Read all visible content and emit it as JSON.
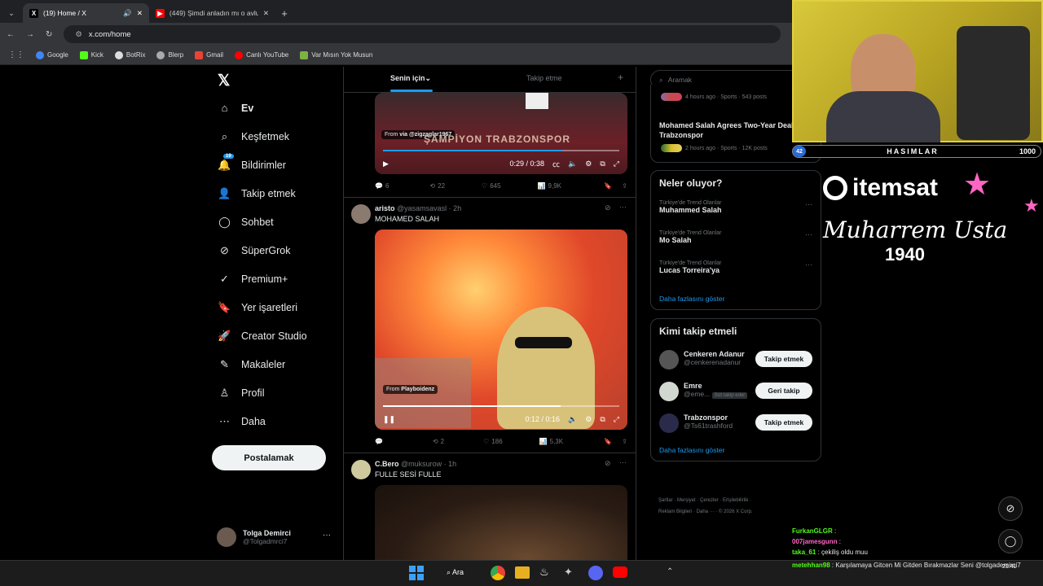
{
  "browser": {
    "tabs": [
      {
        "title": "(19) Home / X",
        "active": true
      },
      {
        "title": "(449) Şimdi anladın mı o avludaki",
        "active": false
      }
    ],
    "address": "x.com/home",
    "bookmarks": [
      "Google",
      "Kick",
      "BotRix",
      "Blerp",
      "Gmail",
      "Canlı YouTube",
      "Var Mısın Yok Musun"
    ]
  },
  "nav": {
    "items": [
      "Ev",
      "Keşfetmek",
      "Bildirimler",
      "Takip etmek",
      "Sohbet",
      "SüperGrok",
      "Premium+",
      "Yer işaretleri",
      "Creator Studio",
      "Makaleler",
      "Profil",
      "Daha"
    ],
    "notif_badge": "19",
    "post_button": "Postalamak",
    "account": {
      "name": "Tolga Demirci",
      "handle": "@Tolgadmrci7",
      "more": "···"
    }
  },
  "feed": {
    "tabs": [
      "Senin için",
      "Takip etme"
    ],
    "tweet1": {
      "from": "From",
      "via": "via @zigzaglar1967",
      "banner": "ŞAMPİYON TRABZONSPOR",
      "time": "0:29 / 0:38",
      "replies": "6",
      "reposts": "22",
      "likes": "645",
      "views": "9,9K",
      "progress": 0.76
    },
    "tweet2": {
      "name": "aristo",
      "handle": "@yasamsavasl · 2h",
      "text": "MOHAMED SALAH",
      "from": "From",
      "source": "Playboidenz",
      "time": "0:12 / 0:16",
      "replies": "",
      "reposts": "2",
      "likes": "186",
      "views": "5,3K",
      "progress": 0.75
    },
    "tweet3": {
      "name": "C.Bero",
      "handle": "@muksurow · 1h",
      "text": "FULLE SESİ FULLE"
    }
  },
  "right": {
    "search_placeholder": "Aramak",
    "news": [
      {
        "meta": "4 hours ago · Sports · 543 posts"
      },
      {
        "title": "Mohamed Salah Agrees Two-Year Deal with Trabzonspor",
        "meta": "2 hours ago · Sports · 12K posts"
      }
    ],
    "trends_title": "Neler oluyor?",
    "trends": [
      {
        "label": "Türkiye'de Trend Olanlar",
        "name": "Muhammed Salah"
      },
      {
        "label": "Türkiye'de Trend Olanlar",
        "name": "Mo Salah"
      },
      {
        "label": "Türkiye'de Trend Olanlar",
        "name": "Lucas Torreira'ya"
      }
    ],
    "show_more": "Daha fazlasını göster",
    "who_title": "Kimi takip etmeli",
    "who": [
      {
        "name": "Cenkeren Adanur",
        "handle": "@cenkerenadanur",
        "button": "Takip etmek",
        "tag": ""
      },
      {
        "name": "Emre",
        "handle": "@eme...",
        "button": "Geri takip",
        "tag": "Sizi takip eder"
      },
      {
        "name": "Trabzonspor",
        "handle": "@Ts61trashford",
        "button": "Takip etmek",
        "tag": ""
      }
    ],
    "footer_line1": "Şartlar · Merşiyet · Çerezler · Erişilebilirlik ·",
    "footer_line2": "Reklam Bilgileri · Daha ··· · © 2026 X Corp."
  },
  "overlay": {
    "bar_label": "HASIMLAR",
    "bar_left": "42",
    "bar_right": "1000",
    "sponsor": "itemsat",
    "signature": "Muharrem Usta",
    "year": "1940",
    "chat": [
      {
        "user": "FurkanGLGR",
        "msg": ""
      },
      {
        "user": "007jamesgunn",
        "msg": ""
      },
      {
        "user": "taka_61",
        "msg": "çekiliş oldu muu"
      },
      {
        "user": "metehhan98",
        "msg": "Karşılamaya Gitcen Mi Gitden Bırakmazlar Seni @tolgademirci7"
      }
    ]
  },
  "taskbar": {
    "search": "Ara",
    "time": "21:41"
  },
  "colors": {
    "accent": "#1d9bf0",
    "bg": "#000000",
    "pink": "#ff66c4"
  }
}
